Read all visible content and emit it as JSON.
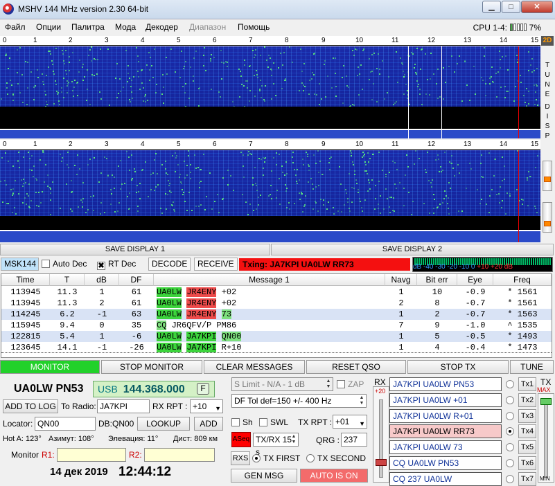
{
  "window": {
    "title": "MSHV 144 MHz version 2.30 64-bit",
    "min": "▁",
    "max": "□",
    "close": "✕"
  },
  "menu": [
    "Файл",
    "Опции",
    "Палитра",
    "Мода",
    "Декодер",
    "Диапазон",
    "Помощь"
  ],
  "cpu": {
    "label": "CPU 1-4:",
    "value": "7%"
  },
  "ruler": [
    "0",
    "1",
    "2",
    "3",
    "4",
    "5",
    "6",
    "7",
    "8",
    "9",
    "10",
    "11",
    "12",
    "13",
    "14",
    "15"
  ],
  "side": {
    "btn2d": "2D",
    "tune": [
      "T",
      "U",
      "N",
      "E"
    ],
    "disp": [
      "D",
      "I",
      "S",
      "P"
    ]
  },
  "save": {
    "d1": "SAVE DISPLAY 1",
    "d2": "SAVE DISPLAY 2"
  },
  "toolbar": {
    "mode": "MSK144",
    "auto_dec": "Auto Dec",
    "rt_dec": "RT Dec",
    "decode": "DECODE",
    "receive": "RECEIVE",
    "txing": "Txing: JA7KPI UA0LW RR73",
    "rt_check": "✖"
  },
  "meter": {
    "scale": "dB -40 -30 -20 -10 0",
    "scale_red": "+10 +20 dB"
  },
  "table": {
    "headers": [
      "Time",
      "T",
      "dB",
      "DF",
      "Message 1",
      "Navg",
      "Bit err",
      "Eye",
      "Freq"
    ],
    "rows": [
      {
        "time": "113945",
        "t": "11.3",
        "db": "1",
        "df": "61",
        "call1": "UA0LW",
        "call2": "JR4ENY",
        "rest": "+02",
        "navg": "1",
        "biterr": "10",
        "eye": "-0.9",
        "freq": "* 1561"
      },
      {
        "time": "113945",
        "t": "11.3",
        "db": "2",
        "df": "61",
        "call1": "UA0LW",
        "call2": "JR4ENY",
        "rest": "+02",
        "navg": "2",
        "biterr": "8",
        "eye": "-0.7",
        "freq": "* 1561"
      },
      {
        "time": "114245",
        "t": "6.2",
        "db": "-1",
        "df": "63",
        "call1": "UA0LW",
        "call2": "JR4ENY",
        "rest": "73",
        "navg": "1",
        "biterr": "2",
        "eye": "-0.7",
        "freq": "* 1563"
      },
      {
        "time": "115945",
        "t": "9.4",
        "db": "0",
        "df": "35",
        "call1": "CQ",
        "call2": "JR6QFV/P",
        "rest": "PM86",
        "navg": "7",
        "biterr": "9",
        "eye": "-1.0",
        "freq": "^ 1535"
      },
      {
        "time": "122815",
        "t": "5.4",
        "db": "1",
        "df": "-6",
        "call1": "UA0LW",
        "call2": "JA7KPI",
        "rest": "QN00",
        "navg": "1",
        "biterr": "5",
        "eye": "-0.5",
        "freq": "* 1493"
      },
      {
        "time": "123645",
        "t": "14.1",
        "db": "-1",
        "df": "-26",
        "call1": "UA0LW",
        "call2": "JA7KPI",
        "rest": "R+10",
        "navg": "1",
        "biterr": "4",
        "eye": "-0.4",
        "freq": "* 1473"
      }
    ]
  },
  "buttons": {
    "monitor": "MONITOR",
    "stop_monitor": "STOP MONITOR",
    "clear": "CLEAR MESSAGES",
    "reset_qso": "RESET QSO",
    "stop_tx": "STOP TX",
    "tune": "TUNE"
  },
  "left": {
    "dx": "UA0LW PN53",
    "mode": "USB",
    "freq": "144.368.000",
    "f_btn": "F",
    "add_to_log": "ADD TO LOG",
    "to_radio_label": "To Radio:",
    "to_radio": "JA7KPI",
    "rx_rpt_label": "RX RPT :",
    "rx_rpt": "+10",
    "locator_label": "Locator:",
    "locator": "QN00",
    "db_label": "DB:QN00",
    "lookup": "LOOKUP",
    "add": "ADD",
    "hot_a": "Hot A: 123°",
    "azimuth": "Азимут: 108°",
    "elevation": "Элевация: 11°",
    "distance": "Дист: 809 км",
    "monitor_label": "Monitor",
    "r1": "R1:",
    "r2": "R2:",
    "date": "14 дек 2019",
    "time": "12:44:12"
  },
  "mid": {
    "s_limit": "S Limit - N/A - 1  dB",
    "zap": "ZAP",
    "df_tol": "DF Tol def=150 +/-  400  Hz",
    "sh": "Sh",
    "swl": "SWL",
    "tx_rpt_label": "TX RPT :",
    "tx_rpt": "+01",
    "aseq": "ASeq",
    "txrx": "TX/RX 15  s",
    "qrg_label": "QRG :",
    "qrg": "237",
    "rxs": "RXS",
    "tx_first": "TX FIRST",
    "tx_second": "TX SECOND",
    "gen_msg": "GEN MSG",
    "auto_is_on": "AUTO IS ON"
  },
  "rx": {
    "label": "RX",
    "val": "+20"
  },
  "tx": {
    "label": "TX",
    "max": "MAX",
    "min": "MIN"
  },
  "txmsgs": [
    {
      "text": "JA7KPI UA0LW PN53",
      "btn": "Tx1"
    },
    {
      "text": "JA7KPI UA0LW +01",
      "btn": "Tx2"
    },
    {
      "text": "JA7KPI UA0LW R+01",
      "btn": "Tx3"
    },
    {
      "text": "JA7KPI UA0LW RR73",
      "btn": "Tx4"
    },
    {
      "text": "JA7KPI UA0LW 73",
      "btn": "Tx5"
    },
    {
      "text": "CQ UA0LW PN53",
      "btn": "Tx6"
    },
    {
      "text": "CQ 237 UA0LW",
      "btn": "Tx7"
    }
  ],
  "colors": {
    "accent_green": "#22d12a",
    "alert_red": "#f41010",
    "waterfall_blue": "#1a2aa8",
    "freq_bg": "#d4f1c6"
  }
}
